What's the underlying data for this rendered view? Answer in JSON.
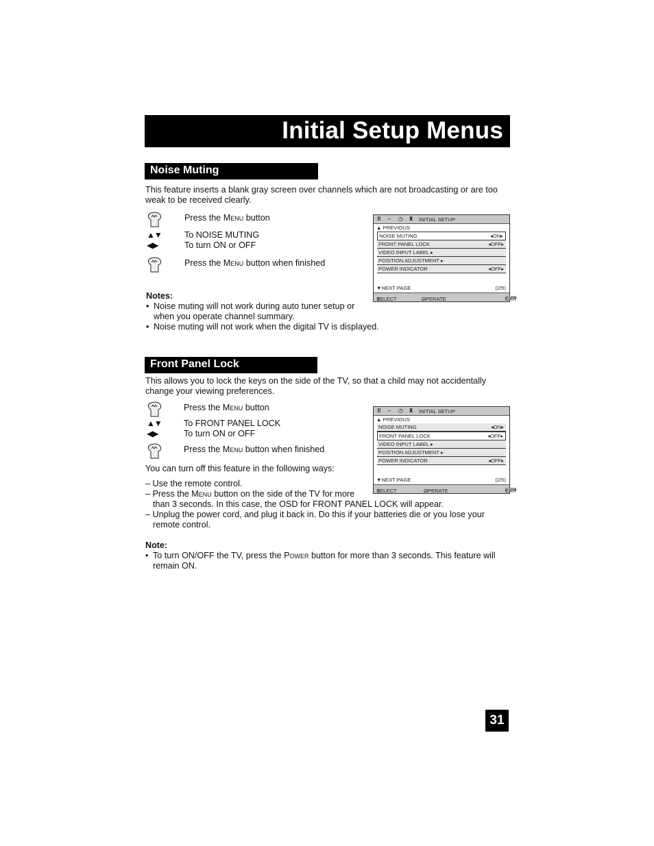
{
  "page_title": "Initial Setup Menus",
  "page_number": "31",
  "noise_muting": {
    "heading": "Noise Muting",
    "intro": "This feature inserts a blank gray screen over channels which are not broadcasting or are too weak to be received clearly.",
    "steps": [
      {
        "icon": "hand-press-icon",
        "pre": "Press the ",
        "key": "Menu",
        "post": " button"
      },
      {
        "icon": "up-down-arrows-icon",
        "glyph": "▲▼",
        "text": "To NOISE MUTING"
      },
      {
        "icon": "left-right-arrows-icon",
        "glyph": "◀▶",
        "text": "To turn ON or OFF"
      },
      {
        "icon": "hand-press-icon",
        "pre": "Press the ",
        "key": "Menu",
        "post": " button when finished"
      }
    ],
    "notes_heading": "Notes:",
    "notes": [
      "Noise muting will not work during auto tuner setup or when you operate channel summary.",
      "Noise muting will not work when the digital TV is displayed."
    ],
    "osd": {
      "title": "INITIAL SETUP",
      "previous": "PREVIOUS",
      "selected_index": 0,
      "items": [
        {
          "label": "NOISE MUTING",
          "value": "ON"
        },
        {
          "label": "FRONT PANEL LOCK",
          "value": "OFF"
        },
        {
          "label": "VIDEO INPUT LABEL",
          "value": ""
        },
        {
          "label": "POSITION ADJUSTMENT",
          "value": ""
        },
        {
          "label": "POWER INDICATOR",
          "value": "OFF"
        }
      ],
      "next_page": "NEXT PAGE",
      "page": "(2/5)",
      "select": "SELECT",
      "operate": "OPERATE",
      "menu_tag": "MENU",
      "exit": "EXIT"
    }
  },
  "front_panel_lock": {
    "heading": "Front Panel Lock",
    "intro": "This allows you to lock the keys on the side of the TV, so that a child may not accidentally change your viewing preferences.",
    "steps": [
      {
        "icon": "hand-press-icon",
        "pre": "Press the ",
        "key": "Menu",
        "post": " button"
      },
      {
        "icon": "up-down-arrows-icon",
        "glyph": "▲▼",
        "text": "To FRONT PANEL LOCK"
      },
      {
        "icon": "left-right-arrows-icon",
        "glyph": "◀▶",
        "text": "To turn ON or OFF"
      },
      {
        "icon": "hand-press-icon",
        "pre": "Press the ",
        "key": "Menu",
        "post": " button when finished"
      }
    ],
    "ways_intro": "You can turn off this feature in the following ways:",
    "ways": {
      "w1": "– Use the remote control.",
      "w2_pre": "– Press the ",
      "w2_key": "Menu",
      "w2_post": " button on the side of the TV for more",
      "w2_cont": "than 3 seconds. In this case, the OSD for FRONT PANEL LOCK will appear.",
      "w3": "– Unplug the power cord, and plug it back in. Do this if your batteries die or you lose your",
      "w3_cont": "remote control."
    },
    "note_heading": "Note:",
    "note_pre": "To turn ON/OFF the TV, press the ",
    "note_key": "Power",
    "note_post": " button for more than 3 seconds. This feature will",
    "note_cont": "remain ON.",
    "osd": {
      "title": "INITIAL SETUP",
      "previous": "PREVIOUS",
      "selected_index": 1,
      "items": [
        {
          "label": "NOISE MUTING",
          "value": "ON"
        },
        {
          "label": "FRONT PANEL LOCK",
          "value": "OFF"
        },
        {
          "label": "VIDEO INPUT LABEL",
          "value": ""
        },
        {
          "label": "POSITION ADJUSTMENT",
          "value": ""
        },
        {
          "label": "POWER INDICATOR",
          "value": "OFF"
        }
      ],
      "next_page": "NEXT PAGE",
      "page": "(2/5)",
      "select": "SELECT",
      "operate": "OPERATE",
      "menu_tag": "MENU",
      "exit": "EXIT"
    }
  }
}
